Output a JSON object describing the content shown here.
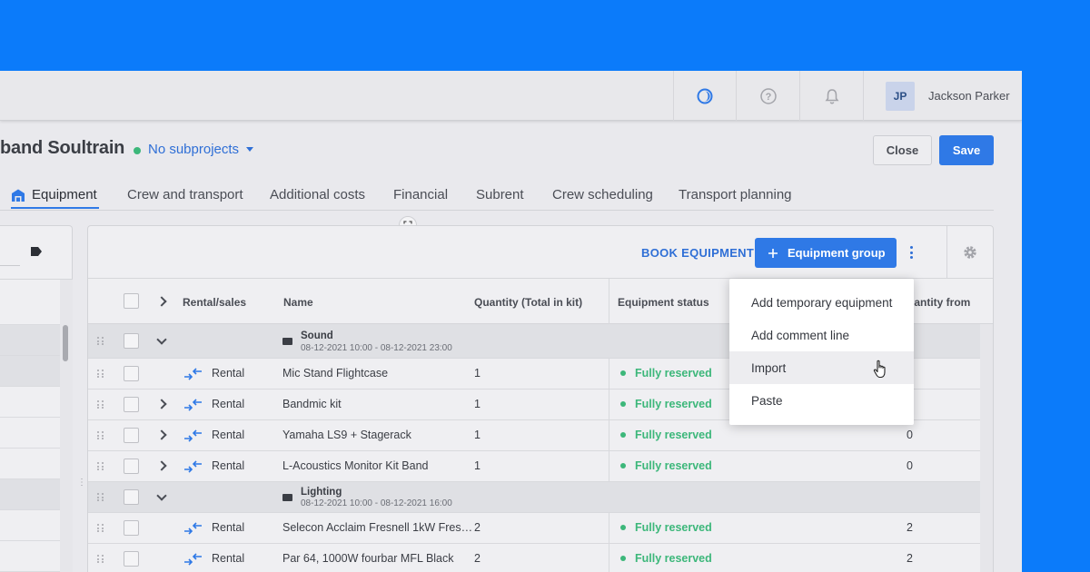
{
  "user": {
    "initials": "JP",
    "name": "Jackson Parker"
  },
  "header": {
    "project_title": "band Soultrain",
    "subprojects_label": "No subprojects",
    "close_label": "Close",
    "save_label": "Save"
  },
  "tabs": [
    {
      "label": "Equipment",
      "active": true
    },
    {
      "label": "Crew and transport"
    },
    {
      "label": "Additional costs"
    },
    {
      "label": "Financial"
    },
    {
      "label": "Subrent"
    },
    {
      "label": "Crew scheduling"
    },
    {
      "label": "Transport planning"
    }
  ],
  "toolbar": {
    "book_label": "BOOK EQUIPMENT",
    "group_label": "Equipment group"
  },
  "table": {
    "columns": [
      "Rental/sales",
      "Name",
      "Quantity (Total in kit)",
      "Equipment status",
      "uantity from"
    ],
    "groups": [
      {
        "name": "Sound",
        "dates": "08-12-2021 10:00 - 08-12-2021 23:00",
        "rows": [
          {
            "type": "Rental",
            "name": "Mic Stand Flightcase",
            "qty": "1",
            "status": "Fully reserved",
            "qty_from": "",
            "expandable": false
          },
          {
            "type": "Rental",
            "name": "Bandmic kit",
            "qty": "1",
            "status": "Fully reserved",
            "qty_from": "",
            "expandable": true
          },
          {
            "type": "Rental",
            "name": "Yamaha LS9 + Stagerack",
            "qty": "1",
            "status": "Fully reserved",
            "qty_from": "0",
            "expandable": true
          },
          {
            "type": "Rental",
            "name": "L-Acoustics Monitor Kit Band",
            "qty": "1",
            "status": "Fully reserved",
            "qty_from": "0",
            "expandable": true
          }
        ]
      },
      {
        "name": "Lighting",
        "dates": "08-12-2021 10:00 - 08-12-2021 16:00",
        "rows": [
          {
            "type": "Rental",
            "name": "Selecon Acclaim Fresnell 1kW Fres…",
            "qty": "2",
            "status": "Fully reserved",
            "qty_from": "2",
            "expandable": false
          },
          {
            "type": "Rental",
            "name": "Par 64, 1000W fourbar MFL Black",
            "qty": "2",
            "status": "Fully reserved",
            "qty_from": "2",
            "expandable": false
          }
        ]
      }
    ]
  },
  "menu": {
    "items": [
      "Add temporary equipment",
      "Add comment line",
      "Import",
      "Paste"
    ],
    "hovered": "Import"
  },
  "colors": {
    "background": "#0b7bfa",
    "accent": "#2f79e6",
    "status_green": "#3cb77a"
  },
  "icons": [
    "moon-icon",
    "help-icon",
    "bell-icon",
    "warehouse-icon",
    "tag-icon",
    "plus-icon",
    "more-vertical-icon",
    "gear-icon",
    "folder-icon",
    "rental-arrows-icon",
    "pointer-cursor-icon"
  ]
}
